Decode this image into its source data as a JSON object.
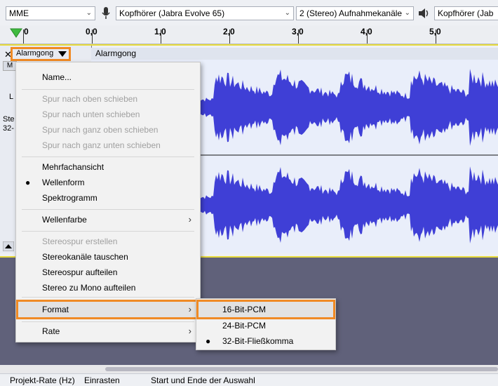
{
  "device_toolbar": {
    "host": "MME",
    "input_device": "Kopfhörer (Jabra Evolve 65)",
    "channels": "2 (Stereo) Aufnahmekanäle",
    "output_device": "Kopfhörer (Jab"
  },
  "ruler": {
    "ticks": [
      "0",
      "0,0",
      "1,0",
      "2,0",
      "3,0",
      "4,0",
      "5,0"
    ]
  },
  "track": {
    "name_dropdown": "Alarmgong",
    "clip_name": "Alarmgong",
    "mute_short": "M",
    "left_label": "L",
    "info_line1": "Ste",
    "info_line2": "32-"
  },
  "context_menu": {
    "items": [
      {
        "label": "Name...",
        "enabled": true
      },
      {
        "label": "Spur nach oben schieben",
        "enabled": false
      },
      {
        "label": "Spur nach unten schieben",
        "enabled": false
      },
      {
        "label": "Spur nach ganz oben schieben",
        "enabled": false
      },
      {
        "label": "Spur nach ganz unten schieben",
        "enabled": false
      },
      {
        "label": "Mehrfachansicht",
        "enabled": true
      },
      {
        "label": "Wellenform",
        "enabled": true,
        "checked": true
      },
      {
        "label": "Spektrogramm",
        "enabled": true
      },
      {
        "label": "Wellenfarbe",
        "enabled": true,
        "submenu": true
      },
      {
        "label": "Stereospur erstellen",
        "enabled": false
      },
      {
        "label": "Stereokanäle tauschen",
        "enabled": true
      },
      {
        "label": "Stereospur aufteilen",
        "enabled": true
      },
      {
        "label": "Stereo zu Mono aufteilen",
        "enabled": true
      },
      {
        "label": "Format",
        "enabled": true,
        "submenu": true,
        "highlighted": true
      },
      {
        "label": "Rate",
        "enabled": true,
        "submenu": true
      }
    ]
  },
  "format_submenu": {
    "items": [
      {
        "label": "16-Bit-PCM",
        "highlighted": true
      },
      {
        "label": "24-Bit-PCM"
      },
      {
        "label": "32-Bit-Fließkomma",
        "checked": true
      }
    ]
  },
  "status_bar": {
    "project_rate": "Projekt-Rate (Hz)",
    "snap": "Einrasten",
    "selection": "Start und Ende der Auswahl"
  },
  "colors": {
    "waveform": "#3f3fd6",
    "highlight_outline": "#f08a24",
    "track_border": "#e7db3b"
  }
}
